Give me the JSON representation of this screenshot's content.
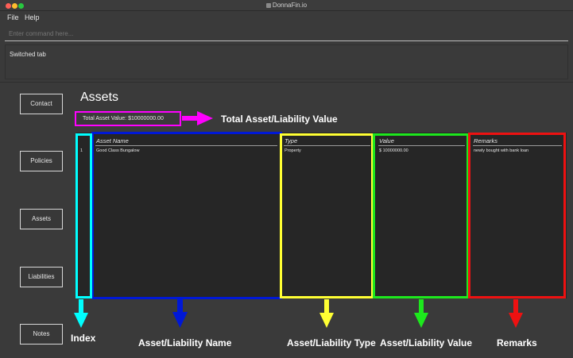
{
  "window": {
    "title": "DonnaFin.io"
  },
  "menu": [
    {
      "label": "File"
    },
    {
      "label": "Help"
    }
  ],
  "command": {
    "placeholder": "Enter command here..."
  },
  "result": {
    "text": "Switched tab"
  },
  "sidebar": {
    "items": [
      {
        "label": "Contact"
      },
      {
        "label": "Policies"
      },
      {
        "label": "Assets"
      },
      {
        "label": "Liabilities"
      },
      {
        "label": "Notes"
      }
    ]
  },
  "main": {
    "title": "Assets",
    "total_label": "Total Asset Value: $10000000.00"
  },
  "table": {
    "columns": {
      "index": "",
      "name": "Asset Name",
      "type": "Type",
      "value": "Value",
      "remarks": "Remarks"
    },
    "rows": [
      {
        "index": "1",
        "name": "Good Class Bungalow",
        "type": "Property",
        "value": "$ 10000000.00",
        "remarks": "newly bought with bank loan"
      }
    ]
  },
  "annotations": {
    "total": "Total Asset/Liability Value",
    "index": "Index",
    "name": "Asset/Liability Name",
    "type": "Asset/Liability Type",
    "value": "Asset/Liability Value",
    "remarks": "Remarks"
  },
  "colors": {
    "magenta": "#ff00ff",
    "cyan": "#00ffff",
    "blue": "#0018d6",
    "yellow": "#ffff33",
    "green": "#1de81d",
    "red": "#ee1111"
  }
}
